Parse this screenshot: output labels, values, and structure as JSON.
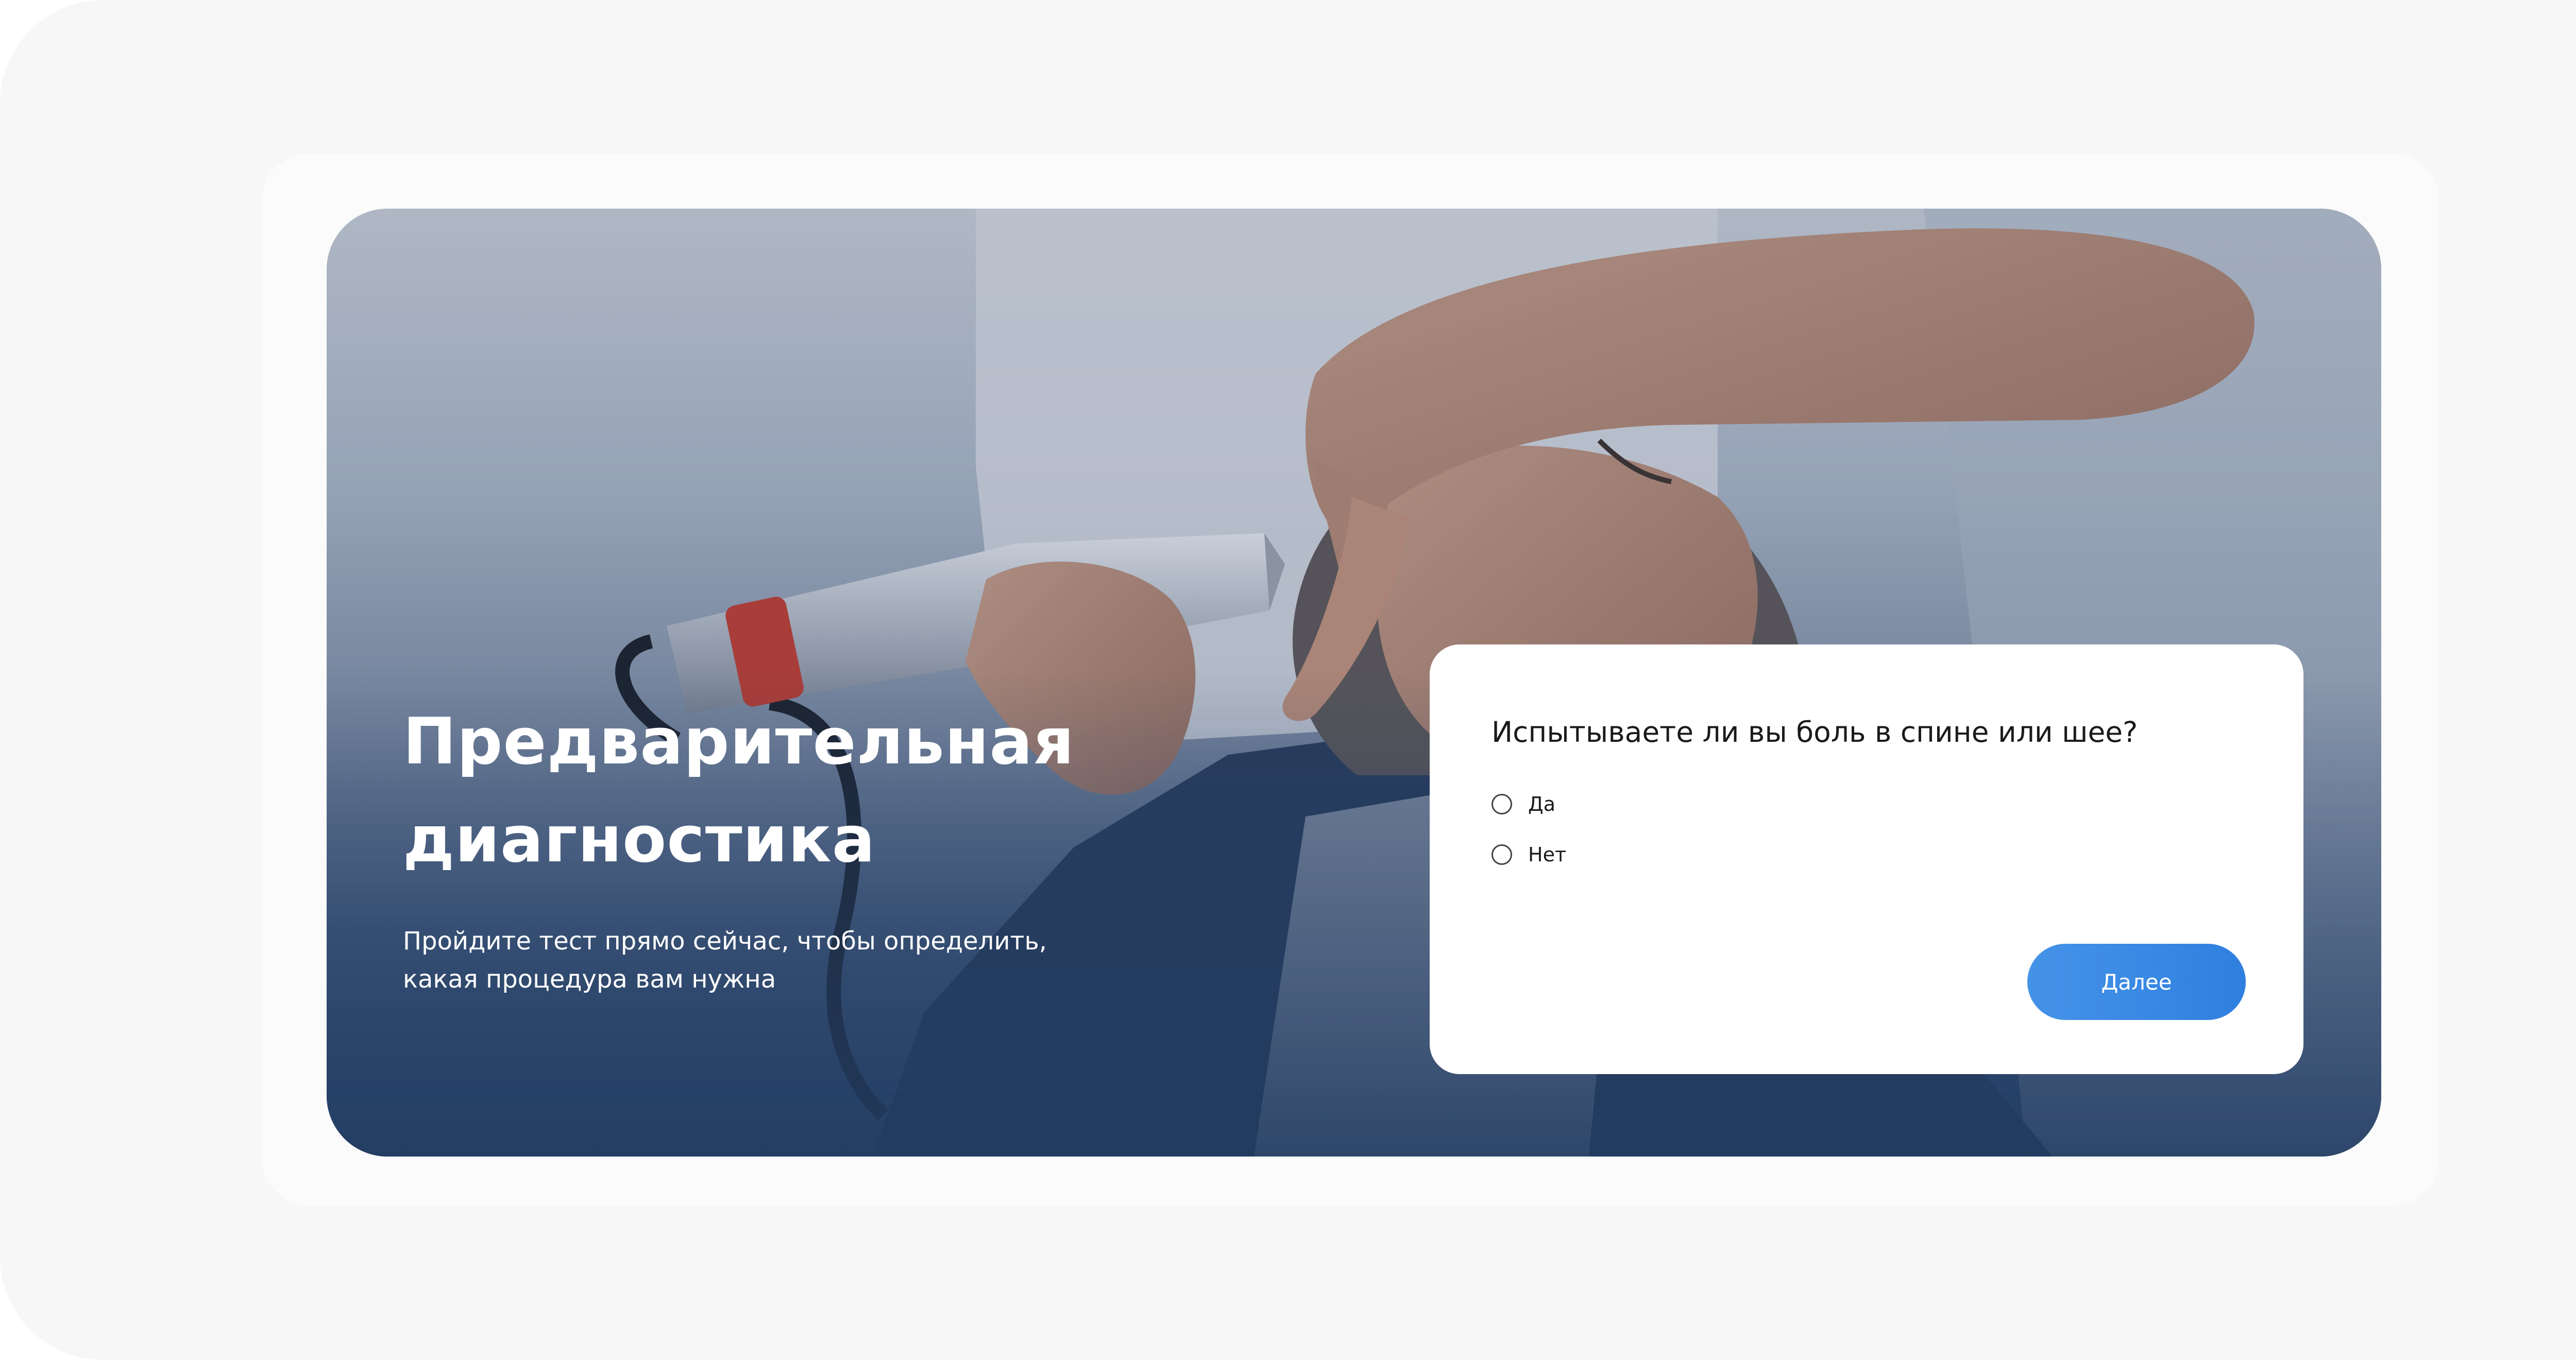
{
  "hero": {
    "title": "Предварительная диагностика",
    "subtitle": "Пройдите тест прямо сейчас, чтобы определить, какая процедура вам нужна"
  },
  "quiz": {
    "question": "Испытываете ли вы боль в спине или шее?",
    "options": [
      {
        "label": "Да",
        "selected": false
      },
      {
        "label": "Нет",
        "selected": false
      }
    ],
    "next_label": "Далее"
  },
  "colors": {
    "page_background": "#f7f7f7",
    "hero_gradient_bottom": "#2b466b",
    "button_blue": "#3a89e4"
  }
}
